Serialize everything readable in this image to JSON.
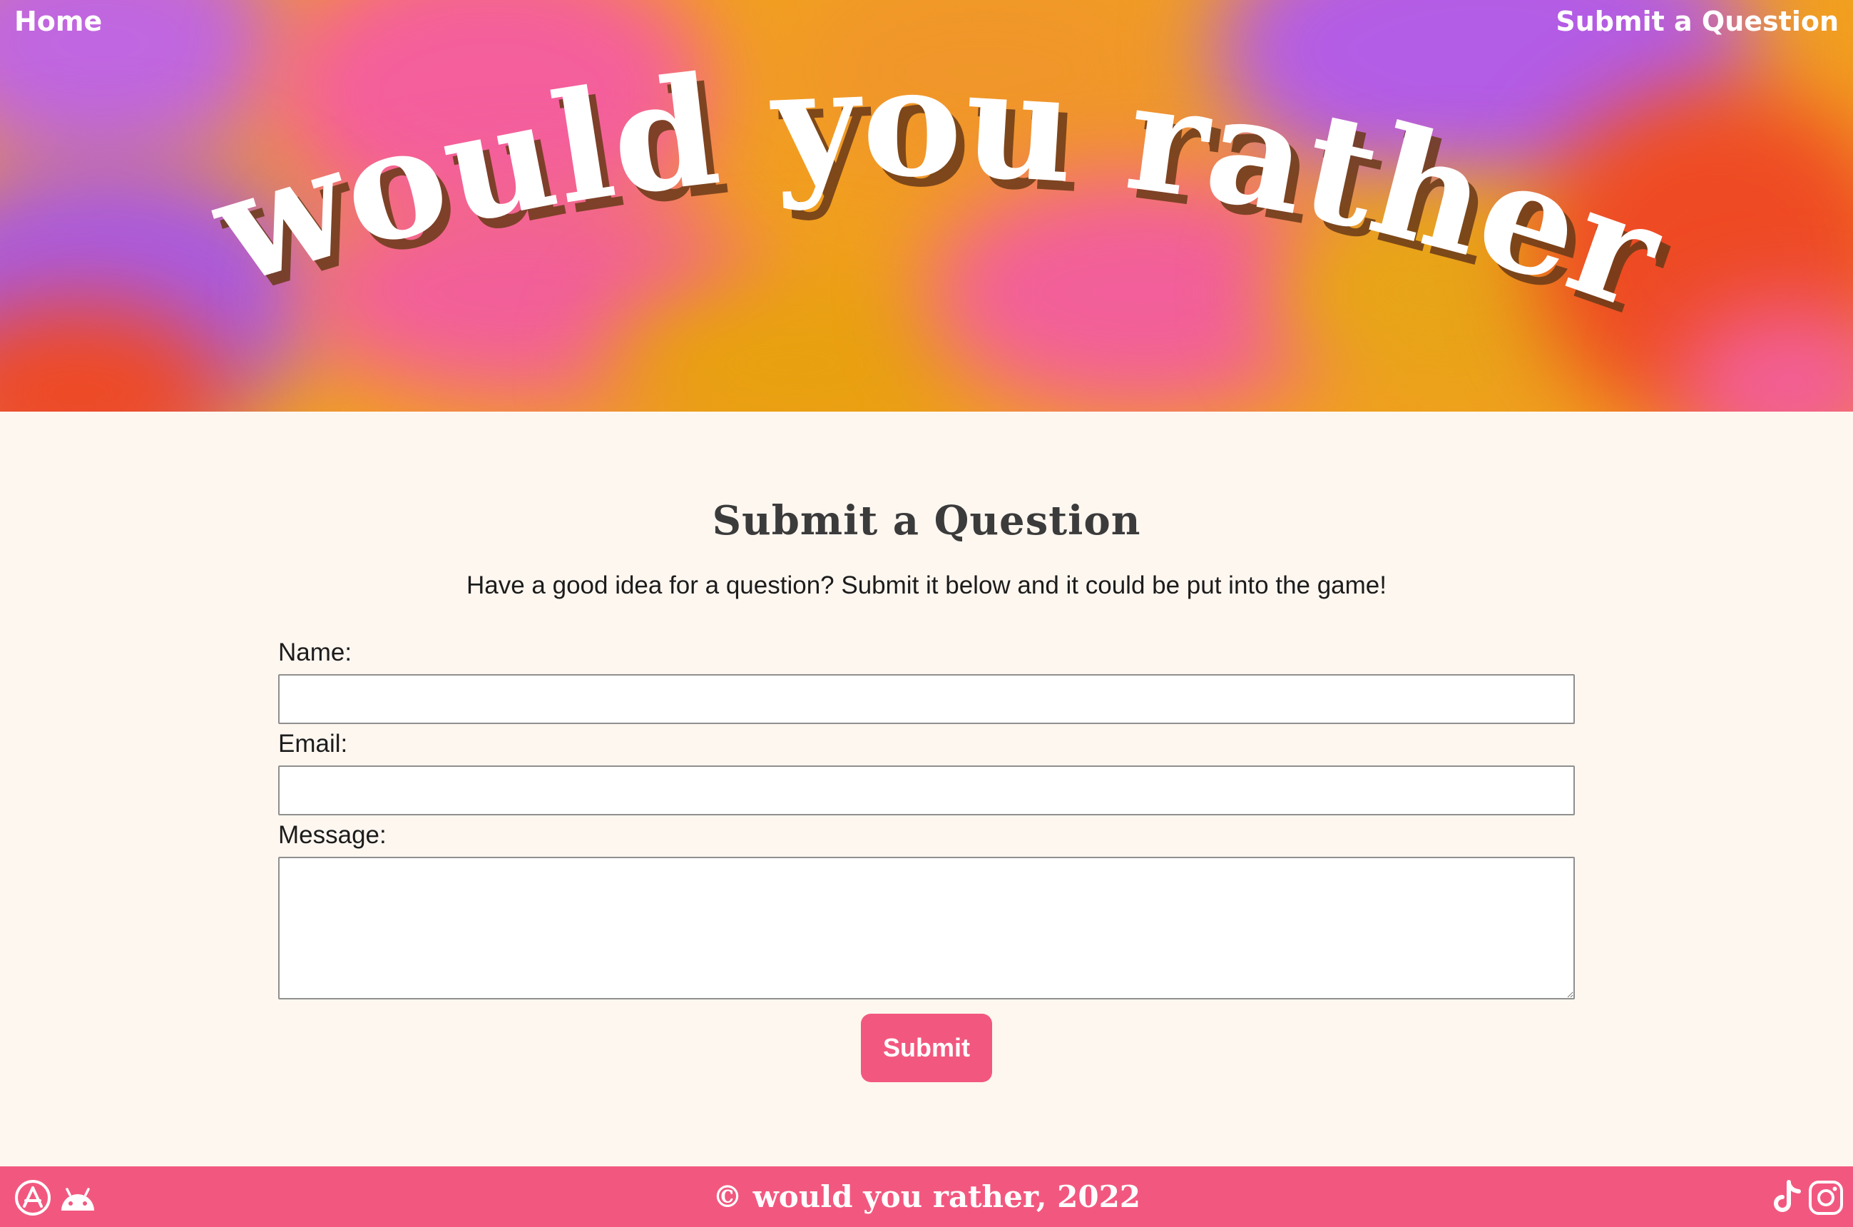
{
  "nav": {
    "home_label": "Home",
    "submit_label": "Submit a Question"
  },
  "hero": {
    "title": "would you rather ..."
  },
  "main": {
    "title": "Submit a Question",
    "subtitle": "Have a good idea for a question? Submit it below and it could be put into the game!",
    "fields": {
      "name_label": "Name:",
      "name_value": "",
      "email_label": "Email:",
      "email_value": "",
      "message_label": "Message:",
      "message_value": ""
    },
    "submit_label": "Submit"
  },
  "footer": {
    "copyright": "© would you rather, 2022",
    "icons": [
      "app-store-icon",
      "android-icon",
      "tiktok-icon",
      "instagram-icon"
    ]
  },
  "colors": {
    "accent": "#f2587f",
    "page_background": "#fef7f0",
    "heading": "#3b3b3b",
    "hero_gradient": [
      "#e8a010",
      "#f25f9a",
      "#b05ce0",
      "#ee4a24"
    ]
  }
}
